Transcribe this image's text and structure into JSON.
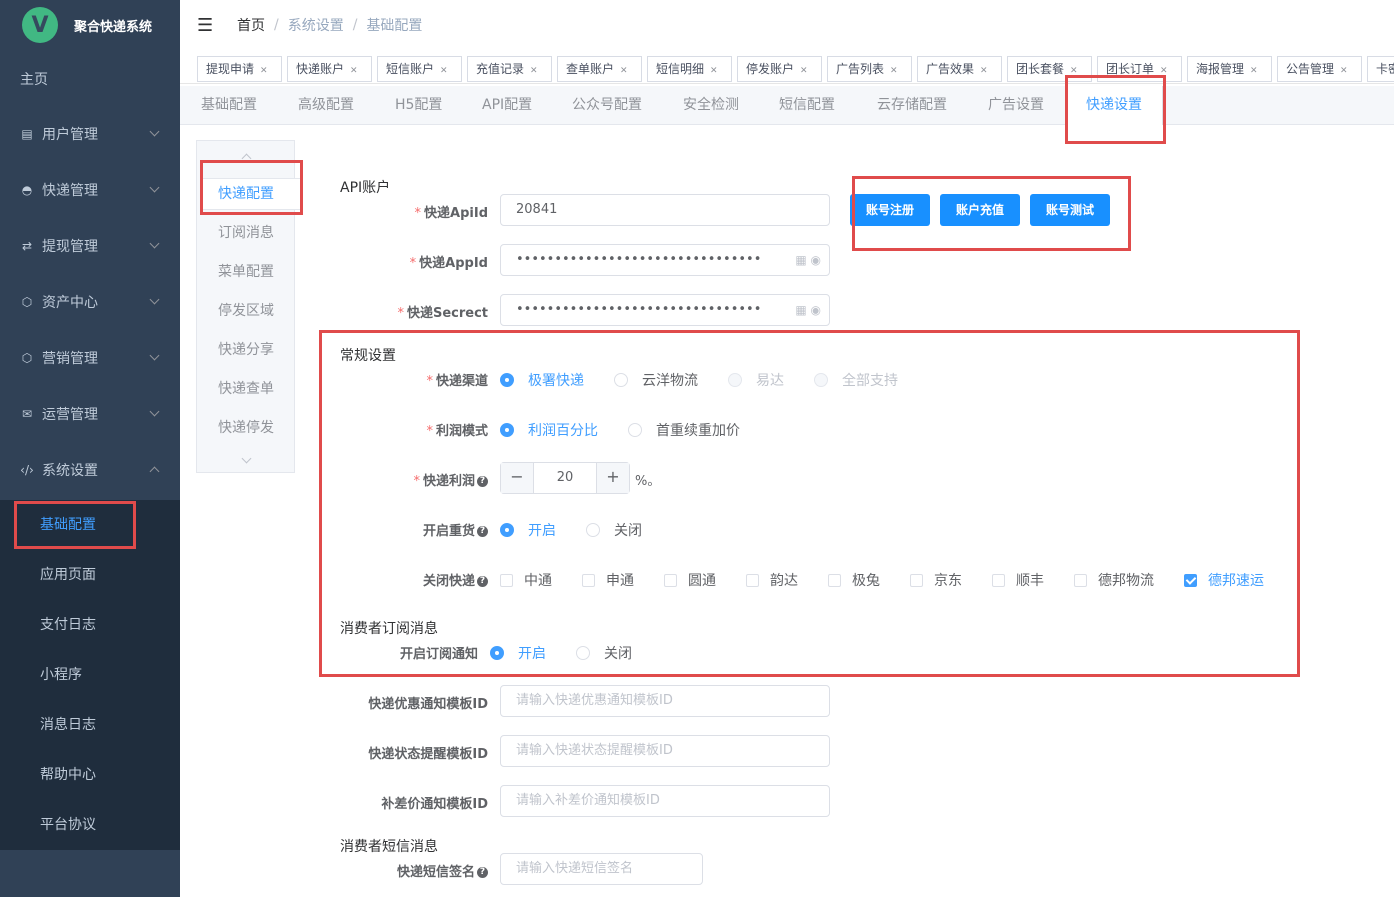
{
  "app": {
    "title": "聚合快递系统",
    "logo_letter": "V"
  },
  "sidebar": {
    "home": "主页",
    "items": [
      {
        "label": "用户管理",
        "icon": "list-icon"
      },
      {
        "label": "快递管理",
        "icon": "chat-icon"
      },
      {
        "label": "提现管理",
        "icon": "money-icon"
      },
      {
        "label": "资产中心",
        "icon": "cube-icon"
      },
      {
        "label": "营销管理",
        "icon": "cube-icon"
      },
      {
        "label": "运营管理",
        "icon": "mail-icon"
      },
      {
        "label": "系统设置",
        "icon": "code-icon"
      }
    ],
    "submenu": [
      "基础配置",
      "应用页面",
      "支付日志",
      "小程序",
      "消息日志",
      "帮助中心",
      "平台协议"
    ]
  },
  "breadcrumb": [
    "首页",
    "系统设置",
    "基础配置"
  ],
  "tags": [
    "提现申请",
    "快递账户",
    "短信账户",
    "充值记录",
    "查单账户",
    "短信明细",
    "停发账户",
    "广告列表",
    "广告效果",
    "团长套餐",
    "团长订单",
    "海报管理",
    "公告管理",
    "卡密"
  ],
  "tabs": [
    "基础配置",
    "高级配置",
    "H5配置",
    "API配置",
    "公众号配置",
    "安全检测",
    "短信配置",
    "云存储配置",
    "广告设置",
    "快递设置"
  ],
  "vtabs": [
    "快递配置",
    "订阅消息",
    "菜单配置",
    "停发区域",
    "快递分享",
    "快递查单",
    "快递停发"
  ],
  "form": {
    "api_section": "API账户",
    "apiid_label": "快递ApiId",
    "apiid_value": "20841",
    "appid_label": "快递AppId",
    "appid_value": "••••••••••••••••••••••••••••••••",
    "secret_label": "快递Secrect",
    "secret_value": "••••••••••••••••••••••••••••••••",
    "buttons": [
      "账号注册",
      "账户充值",
      "账号测试"
    ],
    "general_section": "常规设置",
    "channel_label": "快递渠道",
    "channel_options": [
      "极署快递",
      "云洋物流",
      "易达",
      "全部支持"
    ],
    "profit_mode_label": "利润模式",
    "profit_mode_options": [
      "利润百分比",
      "首重续重加价"
    ],
    "profit_label": "快递利润",
    "profit_value": "20",
    "profit_unit": "%。",
    "reweigh_label": "开启重货",
    "onoff_options": [
      "开启",
      "关闭"
    ],
    "close_express_label": "关闭快递",
    "carriers": [
      "中通",
      "申通",
      "圆通",
      "韵达",
      "极兔",
      "京东",
      "顺丰",
      "德邦物流",
      "德邦速运"
    ],
    "consumer_sub_section": "消费者订阅消息",
    "sub_notify_label": "开启订阅通知",
    "discount_tpl_label": "快递优惠通知模板ID",
    "discount_tpl_ph": "请输入快递优惠通知模板ID",
    "status_tpl_label": "快递状态提醒模板ID",
    "status_tpl_ph": "请输入快递状态提醒模板ID",
    "diff_tpl_label": "补差价通知模板ID",
    "diff_tpl_ph": "请输入补差价通知模板ID",
    "consumer_sms_section": "消费者短信消息",
    "sms_sign_label": "快递短信签名",
    "sms_sign_ph": "请输入快递短信签名"
  },
  "colors": {
    "sidebar": "#304156",
    "submenu": "#1f2d3d",
    "accent": "#409eff",
    "highlight": "#e04b4b",
    "button": "#1890ff"
  }
}
